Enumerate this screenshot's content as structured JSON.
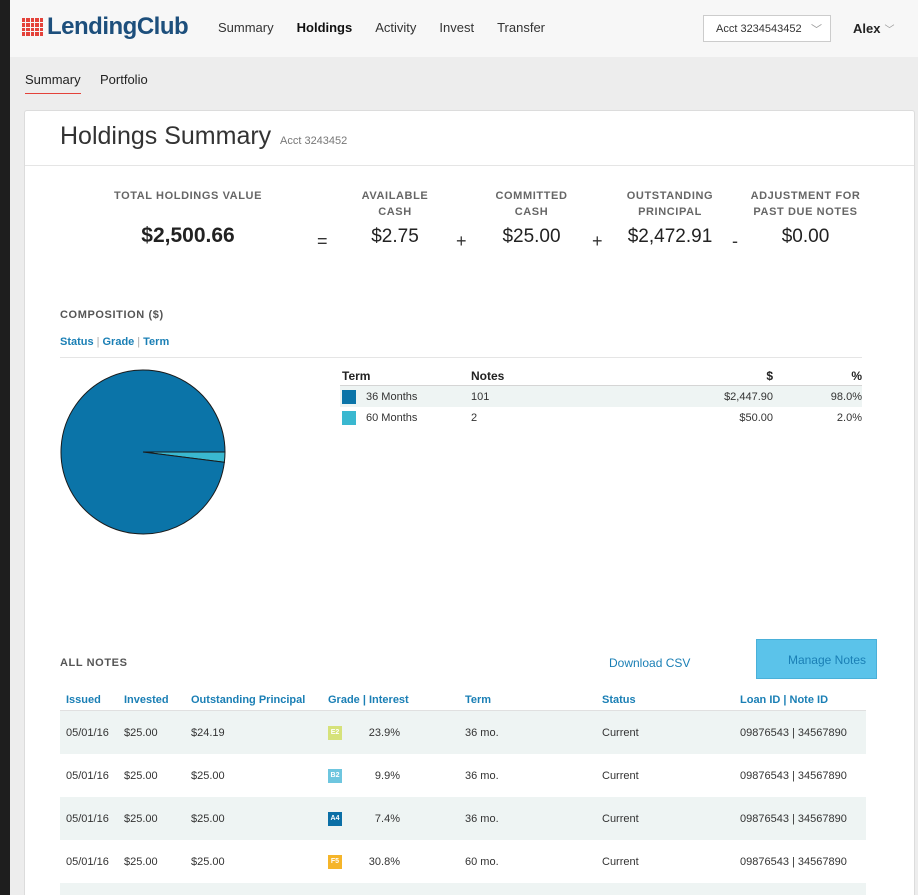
{
  "brand": {
    "name": "LendingClub"
  },
  "nav": {
    "links": [
      "Summary",
      "Holdings",
      "Activity",
      "Invest",
      "Transfer"
    ],
    "active": "Holdings",
    "account_select": "Acct 3234543452",
    "user": "Alex"
  },
  "subnav": {
    "tabs": [
      "Summary",
      "Portfolio"
    ],
    "active": "Summary"
  },
  "page": {
    "title": "Holdings Summary",
    "acct": "Acct 3243452"
  },
  "summary": {
    "total_label": "TOTAL HOLDINGS VALUE",
    "total_value": "$2,500.66",
    "items": [
      {
        "label_line1": "AVAILABLE",
        "label_line2": "CASH",
        "value": "$2.75",
        "op_before": "="
      },
      {
        "label_line1": "COMMITTED",
        "label_line2": "CASH",
        "value": "$25.00",
        "op_before": "+"
      },
      {
        "label_line1": "OUTSTANDING",
        "label_line2": "PRINCIPAL",
        "value": "$2,472.91",
        "op_before": "+"
      },
      {
        "label_line1": "ADJUSTMENT FOR",
        "label_line2": "PAST DUE NOTES",
        "value": "$0.00",
        "op_before": "-"
      }
    ]
  },
  "composition": {
    "label": "COMPOSITION ($)",
    "filters": [
      "Status",
      "Grade",
      "Term"
    ],
    "headers": {
      "term": "Term",
      "notes": "Notes",
      "usd": "$",
      "pct": "%"
    },
    "rows": [
      {
        "term": "36 Months",
        "notes": "101",
        "usd": "$2,447.90",
        "pct": "98.0%",
        "color": "#0b74a8",
        "fraction": 0.98
      },
      {
        "term": "60 Months",
        "notes": "2",
        "usd": "$50.00",
        "pct": "2.0%",
        "color": "#3ab8d0",
        "fraction": 0.02
      }
    ]
  },
  "notes": {
    "label": "ALL NOTES",
    "download": "Download CSV",
    "manage": "Manage Notes",
    "headers": {
      "issued": "Issued",
      "invested": "Invested",
      "outstanding": "Outstanding Principal",
      "grade": "Grade | Interest",
      "term": "Term",
      "status": "Status",
      "loan": "Loan ID | Note ID"
    },
    "rows": [
      {
        "issued": "05/01/16",
        "invested": "$25.00",
        "outstanding": "$24.19",
        "grade": "E2",
        "grade_color": "#d6e27a",
        "rate": "23.9%",
        "term": "36 mo.",
        "status": "Current",
        "loan": "09876543 | 34567890"
      },
      {
        "issued": "05/01/16",
        "invested": "$25.00",
        "outstanding": "$25.00",
        "grade": "B2",
        "grade_color": "#6ec6df",
        "rate": "9.9%",
        "term": "36 mo.",
        "status": "Current",
        "loan": "09876543 | 34567890"
      },
      {
        "issued": "05/01/16",
        "invested": "$25.00",
        "outstanding": "$25.00",
        "grade": "A4",
        "grade_color": "#0b6fa6",
        "rate": "7.4%",
        "term": "36 mo.",
        "status": "Current",
        "loan": "09876543 | 34567890"
      },
      {
        "issued": "05/01/16",
        "invested": "$25.00",
        "outstanding": "$25.00",
        "grade": "F5",
        "grade_color": "#f5b52a",
        "rate": "30.8%",
        "term": "60 mo.",
        "status": "Current",
        "loan": "09876543 | 34567890"
      }
    ]
  }
}
